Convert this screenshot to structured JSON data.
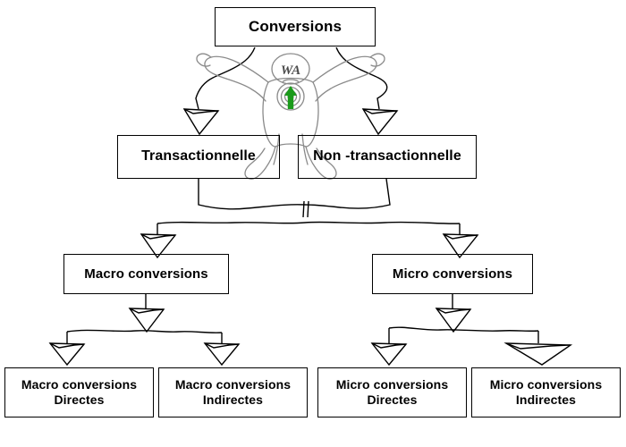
{
  "diagram": {
    "title": "Conversions",
    "background_color": "#ffffff",
    "line_color": "#000000",
    "watermark_color": "#808080",
    "accent_color": "#1a9a1a",
    "style": "hand-drawn flowchart",
    "watermark": {
      "name": "web-analytics-figure",
      "head_label": "WA",
      "chest_icon": "green-up-arrow-target"
    },
    "levels": [
      {
        "level": 0,
        "nodes": [
          {
            "id": "conversions",
            "label": "Conversions"
          }
        ]
      },
      {
        "level": 1,
        "nodes": [
          {
            "id": "transactionnelle",
            "label": "Transactionnelle"
          },
          {
            "id": "non-transactionnelle",
            "label": "Non -transactionnelle"
          }
        ]
      },
      {
        "level": 2,
        "nodes": [
          {
            "id": "macro-conversions",
            "label": "Macro conversions"
          },
          {
            "id": "micro-conversions",
            "label": "Micro conversions"
          }
        ]
      },
      {
        "level": 3,
        "nodes": [
          {
            "id": "macro-directes",
            "label": "Macro conversions\nDirectes"
          },
          {
            "id": "macro-indirectes",
            "label": "Macro conversions\nIndirectes"
          },
          {
            "id": "micro-directes",
            "label": "Micro conversions\nDirectes"
          },
          {
            "id": "micro-indirectes",
            "label": "Micro conversions\nIndirectes"
          }
        ]
      }
    ],
    "edges": [
      {
        "from": "conversions",
        "to": "transactionnelle"
      },
      {
        "from": "conversions",
        "to": "non-transactionnelle"
      },
      {
        "from": "transactionnelle",
        "to": "macro-conversions"
      },
      {
        "from": "transactionnelle",
        "to": "micro-conversions"
      },
      {
        "from": "non-transactionnelle",
        "to": "macro-conversions"
      },
      {
        "from": "non-transactionnelle",
        "to": "micro-conversions"
      },
      {
        "from": "macro-conversions",
        "to": "macro-directes"
      },
      {
        "from": "macro-conversions",
        "to": "macro-indirectes"
      },
      {
        "from": "micro-conversions",
        "to": "micro-directes"
      },
      {
        "from": "micro-conversions",
        "to": "micro-indirectes"
      }
    ]
  }
}
